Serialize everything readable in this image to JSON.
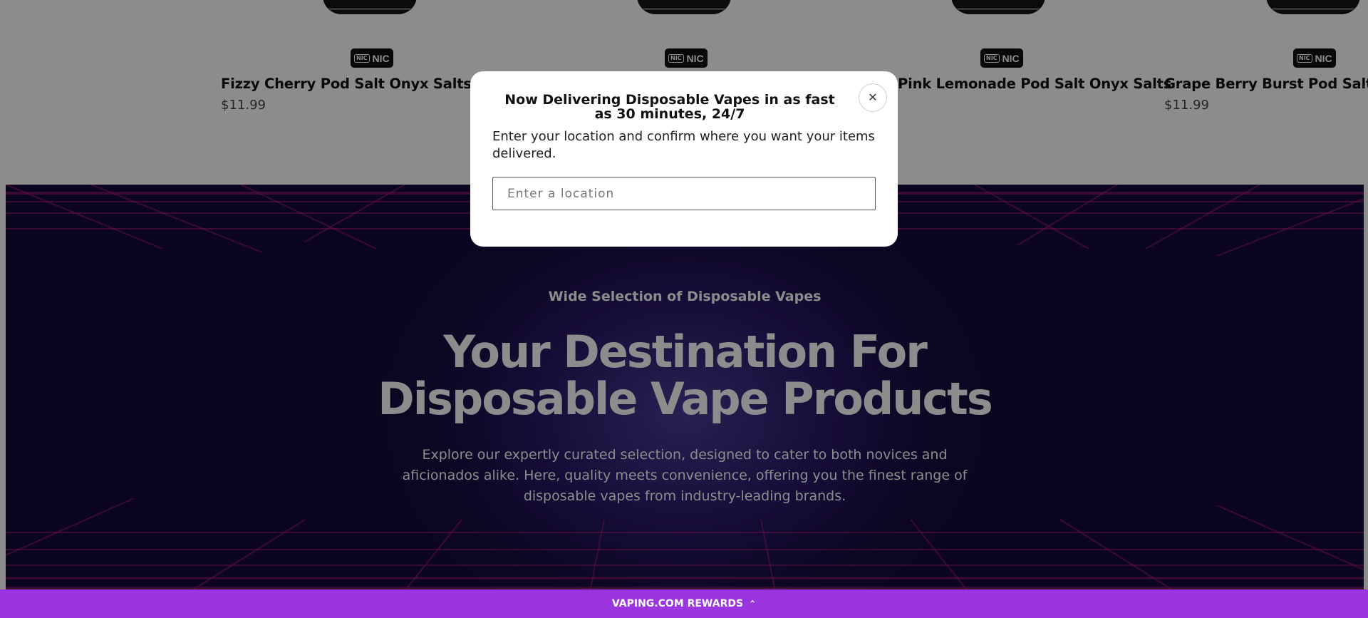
{
  "products": [
    {
      "name": "Fizzy Cherry Pod Salt Onyx Salts",
      "price": "$11.99",
      "badge": "NIC",
      "badge_icon": "NIC"
    },
    {
      "name": "",
      "price": "",
      "badge": "NIC",
      "badge_icon": "NIC"
    },
    {
      "name": "Pink Lemonade Pod Salt Onyx Salts",
      "price": "",
      "badge": "NIC",
      "badge_icon": "NIC"
    },
    {
      "name": "Grape Berry Burst Pod Salt Or",
      "price": "$11.99",
      "badge": "NIC",
      "badge_icon": "NIC"
    }
  ],
  "hero": {
    "eyebrow": "Wide Selection of Disposable Vapes",
    "headline_line1": "Your Destination For",
    "headline_line2": "Disposable Vape Products",
    "description": "Explore our expertly curated selection, designed to cater to both novices and aficionados alike. Here, quality meets convenience, offering you the finest range of disposable vapes from industry-leading brands."
  },
  "modal": {
    "title": "Now Delivering Disposable Vapes in as fast as 30 minutes, 24/7",
    "subtitle": "Enter your location and confirm where you want your items delivered.",
    "location_placeholder": "Enter a location",
    "close_icon": "close-icon"
  },
  "rewards": {
    "label": "VAPING.COM REWARDS",
    "icon": "chevron-up-icon"
  },
  "colors": {
    "rewards_bar": "#9b35e0",
    "hero_background": "#1b0e46",
    "grid_lines": "#b21e72"
  }
}
